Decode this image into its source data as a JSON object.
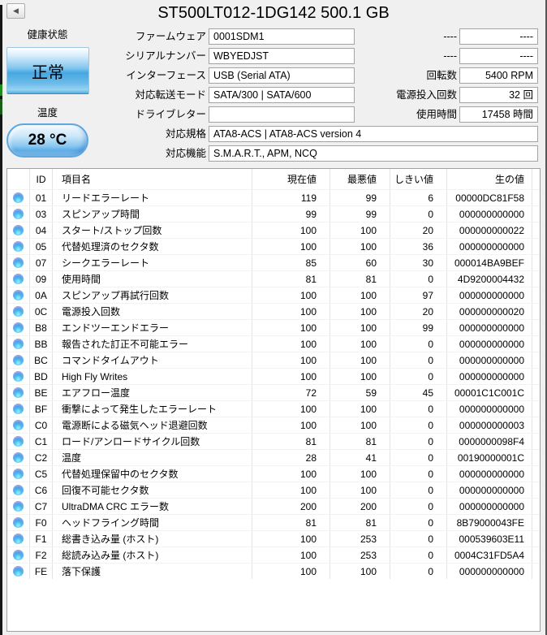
{
  "window": {
    "title": "ST500LT012-1DG142 500.1 GB"
  },
  "icons": {
    "back": "◀"
  },
  "health": {
    "label": "健康状態",
    "status": "正常"
  },
  "temperature": {
    "label": "温度",
    "value": "28 °C"
  },
  "info_left": [
    {
      "label": "ファームウェア",
      "value": "0001SDM1",
      "wide": false
    },
    {
      "label": "シリアルナンバー",
      "value": "WBYEDJST",
      "wide": false
    },
    {
      "label": "インターフェース",
      "value": "USB (Serial ATA)",
      "wide": false
    },
    {
      "label": "対応転送モード",
      "value": "SATA/300 | SATA/600",
      "wide": false
    },
    {
      "label": "ドライブレター",
      "value": "",
      "wide": false
    },
    {
      "label": "対応規格",
      "value": "ATA8-ACS | ATA8-ACS version 4",
      "wide": true
    },
    {
      "label": "対応機能",
      "value": "S.M.A.R.T., APM, NCQ",
      "wide": true
    }
  ],
  "info_right": [
    {
      "label": "----",
      "value": "----"
    },
    {
      "label": "----",
      "value": "----"
    },
    {
      "label": "回転数",
      "value": "5400 RPM"
    },
    {
      "label": "電源投入回数",
      "value": "32 回"
    },
    {
      "label": "使用時間",
      "value": "17458 時間"
    }
  ],
  "smart_table": {
    "headers": {
      "id": "ID",
      "name": "項目名",
      "current": "現在値",
      "worst": "最悪値",
      "threshold": "しきい値",
      "raw": "生の値"
    },
    "rows": [
      {
        "id": "01",
        "name": "リードエラーレート",
        "current": "119",
        "worst": "99",
        "threshold": "6",
        "raw": "00000DC81F58"
      },
      {
        "id": "03",
        "name": "スピンアップ時間",
        "current": "99",
        "worst": "99",
        "threshold": "0",
        "raw": "000000000000"
      },
      {
        "id": "04",
        "name": "スタート/ストップ回数",
        "current": "100",
        "worst": "100",
        "threshold": "20",
        "raw": "000000000022"
      },
      {
        "id": "05",
        "name": "代替処理済のセクタ数",
        "current": "100",
        "worst": "100",
        "threshold": "36",
        "raw": "000000000000"
      },
      {
        "id": "07",
        "name": "シークエラーレート",
        "current": "85",
        "worst": "60",
        "threshold": "30",
        "raw": "000014BA9BEF"
      },
      {
        "id": "09",
        "name": "使用時間",
        "current": "81",
        "worst": "81",
        "threshold": "0",
        "raw": "4D9200004432"
      },
      {
        "id": "0A",
        "name": "スピンアップ再試行回数",
        "current": "100",
        "worst": "100",
        "threshold": "97",
        "raw": "000000000000"
      },
      {
        "id": "0C",
        "name": "電源投入回数",
        "current": "100",
        "worst": "100",
        "threshold": "20",
        "raw": "000000000020"
      },
      {
        "id": "B8",
        "name": "エンドツーエンドエラー",
        "current": "100",
        "worst": "100",
        "threshold": "99",
        "raw": "000000000000"
      },
      {
        "id": "BB",
        "name": "報告された訂正不可能エラー",
        "current": "100",
        "worst": "100",
        "threshold": "0",
        "raw": "000000000000"
      },
      {
        "id": "BC",
        "name": "コマンドタイムアウト",
        "current": "100",
        "worst": "100",
        "threshold": "0",
        "raw": "000000000000"
      },
      {
        "id": "BD",
        "name": "High Fly Writes",
        "current": "100",
        "worst": "100",
        "threshold": "0",
        "raw": "000000000000"
      },
      {
        "id": "BE",
        "name": "エアフロー温度",
        "current": "72",
        "worst": "59",
        "threshold": "45",
        "raw": "00001C1C001C"
      },
      {
        "id": "BF",
        "name": "衝撃によって発生したエラーレート",
        "current": "100",
        "worst": "100",
        "threshold": "0",
        "raw": "000000000000"
      },
      {
        "id": "C0",
        "name": "電源断による磁気ヘッド退避回数",
        "current": "100",
        "worst": "100",
        "threshold": "0",
        "raw": "000000000003"
      },
      {
        "id": "C1",
        "name": "ロード/アンロードサイクル回数",
        "current": "81",
        "worst": "81",
        "threshold": "0",
        "raw": "0000000098F4"
      },
      {
        "id": "C2",
        "name": "温度",
        "current": "28",
        "worst": "41",
        "threshold": "0",
        "raw": "00190000001C"
      },
      {
        "id": "C5",
        "name": "代替処理保留中のセクタ数",
        "current": "100",
        "worst": "100",
        "threshold": "0",
        "raw": "000000000000"
      },
      {
        "id": "C6",
        "name": "回復不可能セクタ数",
        "current": "100",
        "worst": "100",
        "threshold": "0",
        "raw": "000000000000"
      },
      {
        "id": "C7",
        "name": "UltraDMA CRC エラー数",
        "current": "200",
        "worst": "200",
        "threshold": "0",
        "raw": "000000000000"
      },
      {
        "id": "F0",
        "name": "ヘッドフライング時間",
        "current": "81",
        "worst": "81",
        "threshold": "0",
        "raw": "8B79000043FE"
      },
      {
        "id": "F1",
        "name": "総書き込み量 (ホスト)",
        "current": "100",
        "worst": "253",
        "threshold": "0",
        "raw": "000539603E11"
      },
      {
        "id": "F2",
        "name": "総読み込み量 (ホスト)",
        "current": "100",
        "worst": "253",
        "threshold": "0",
        "raw": "0004C31FD5A4"
      },
      {
        "id": "FE",
        "name": "落下保護",
        "current": "100",
        "worst": "100",
        "threshold": "0",
        "raw": "000000000000"
      }
    ]
  },
  "colors": {
    "status_good_blue": "#46a7e1",
    "indicator_dot_blue": "#4ac0f0",
    "panel_border": "#a0a0a0",
    "edge_green": "#1e8c1e"
  }
}
